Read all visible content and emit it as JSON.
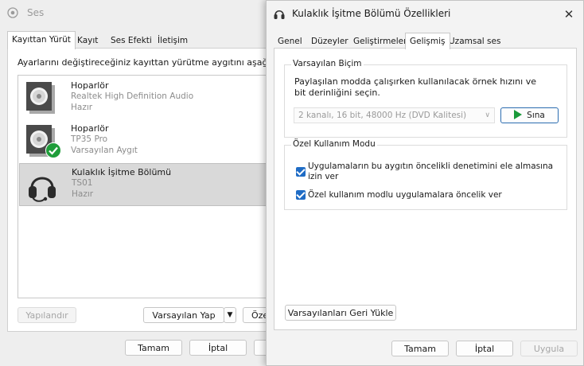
{
  "ses": {
    "title": "Ses",
    "tabs": [
      "Kayıttan Yürüt",
      "Kayıt",
      "Ses Efekti",
      "İletişim"
    ],
    "instruction": "Ayarlarını değiştireceğiniz kayıttan yürütme aygıtını aşağıdan",
    "devices": [
      {
        "name": "Hoparlör",
        "line1": "Realtek High Definition Audio",
        "line2": "Hazır"
      },
      {
        "name": "Hoparlör",
        "line1": "TP35 Pro",
        "line2": "Varsayılan Aygıt"
      },
      {
        "name": "Kulaklık İşitme Bölümü",
        "line1": "TS01",
        "line2": "Hazır"
      }
    ],
    "configure_label": "Yapılandır",
    "set_default_label": "Varsayılan Yap",
    "properties_label": "Öze",
    "ok_label": "Tamam",
    "cancel_label": "İptal"
  },
  "props": {
    "title": "Kulaklık İşitme Bölümü Özellikleri",
    "close_glyph": "✕",
    "tabs": [
      "Genel",
      "Düzeyler",
      "Geliştirmeler",
      "Gelişmiş",
      "Uzamsal ses"
    ],
    "default_format": {
      "legend": "Varsayılan Biçim",
      "description": "Paylaşılan modda çalışırken kullanılacak örnek hızını ve bit derinliğini seçin.",
      "selected_format": "2 kanalı, 16 bit, 48000 Hz (DVD Kalitesi)",
      "test_label": "Sına"
    },
    "exclusive_mode": {
      "legend": "Özel Kullanım Modu",
      "option1": "Uygulamaların bu aygıtın öncelikli denetimini ele almasına izin ver",
      "option1_checked": true,
      "option2": "Özel kullanım modlu uygulamalara öncelik ver",
      "option2_checked": true
    },
    "restore_defaults_label": "Varsayılanları Geri Yükle",
    "ok_label": "Tamam",
    "cancel_label": "İptal",
    "apply_label": "Uygula"
  },
  "colors": {
    "accent": "#1f6cc5",
    "play": "#1a9a3a",
    "check_badge": "#1f9d3a"
  }
}
